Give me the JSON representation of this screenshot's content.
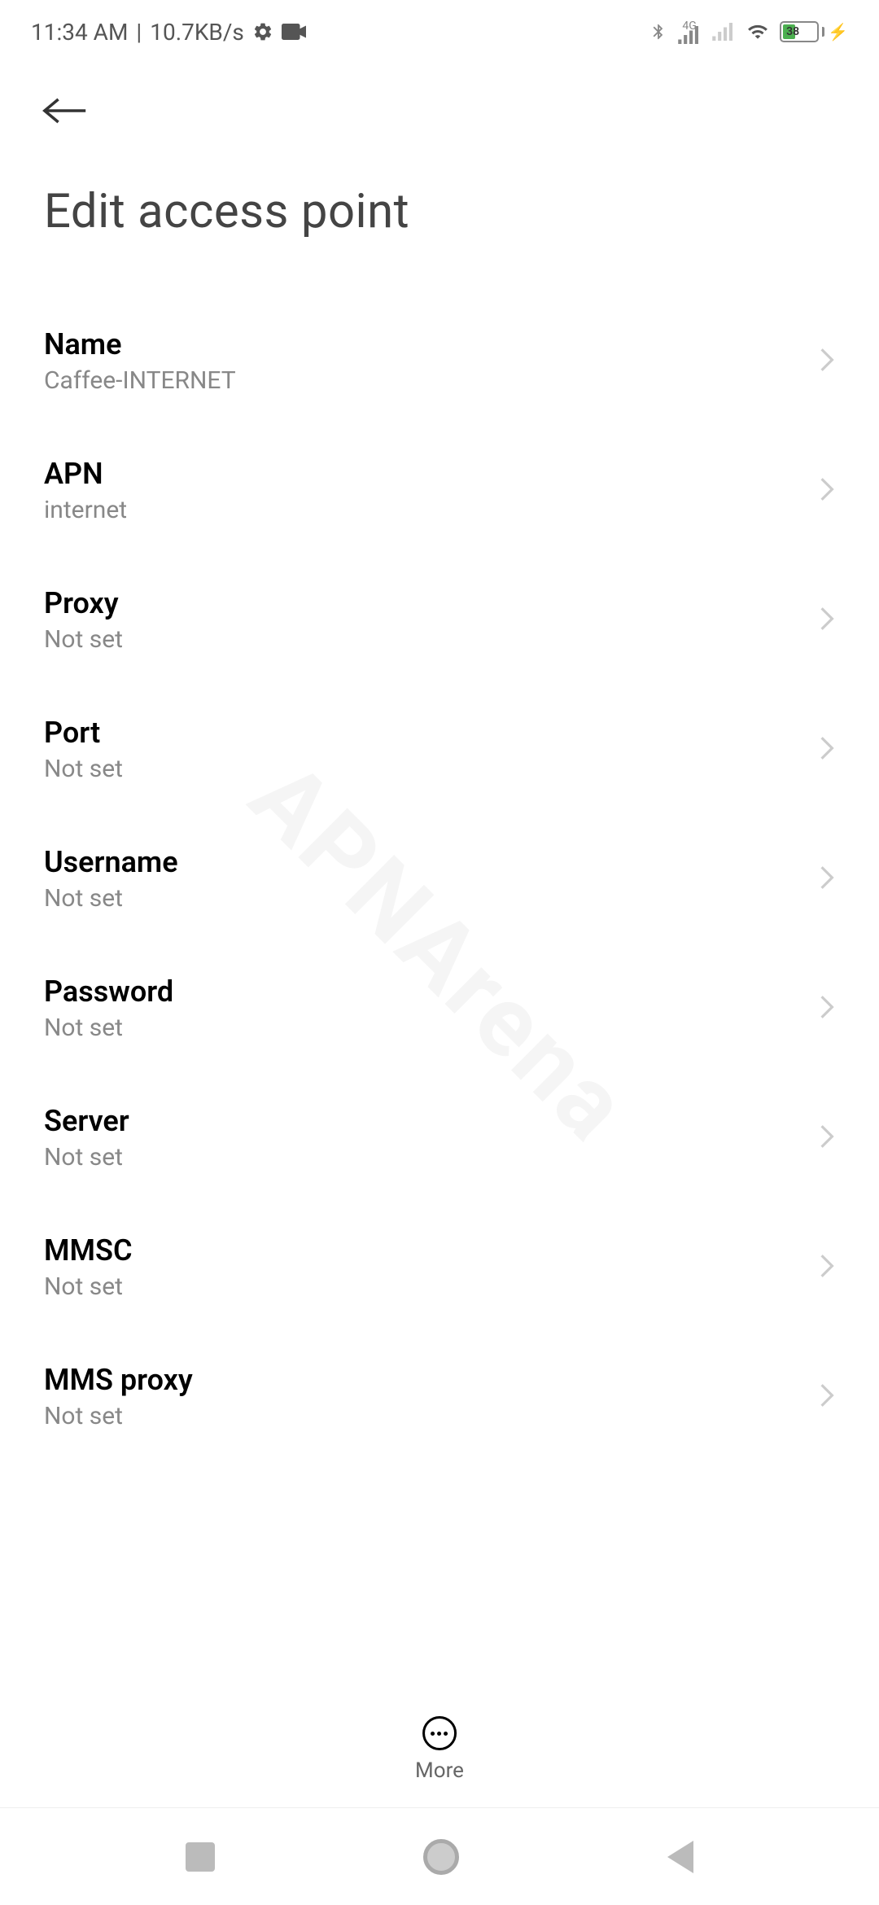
{
  "status_bar": {
    "time": "11:34 AM",
    "separator": "|",
    "data_speed": "10.7KB/s",
    "network_label": "4G",
    "battery_percent": "38"
  },
  "page": {
    "title": "Edit access point"
  },
  "settings": [
    {
      "label": "Name",
      "value": "Caffee-INTERNET"
    },
    {
      "label": "APN",
      "value": "internet"
    },
    {
      "label": "Proxy",
      "value": "Not set"
    },
    {
      "label": "Port",
      "value": "Not set"
    },
    {
      "label": "Username",
      "value": "Not set"
    },
    {
      "label": "Password",
      "value": "Not set"
    },
    {
      "label": "Server",
      "value": "Not set"
    },
    {
      "label": "MMSC",
      "value": "Not set"
    },
    {
      "label": "MMS proxy",
      "value": "Not set"
    }
  ],
  "more": {
    "label": "More"
  },
  "watermark": "APNArena"
}
